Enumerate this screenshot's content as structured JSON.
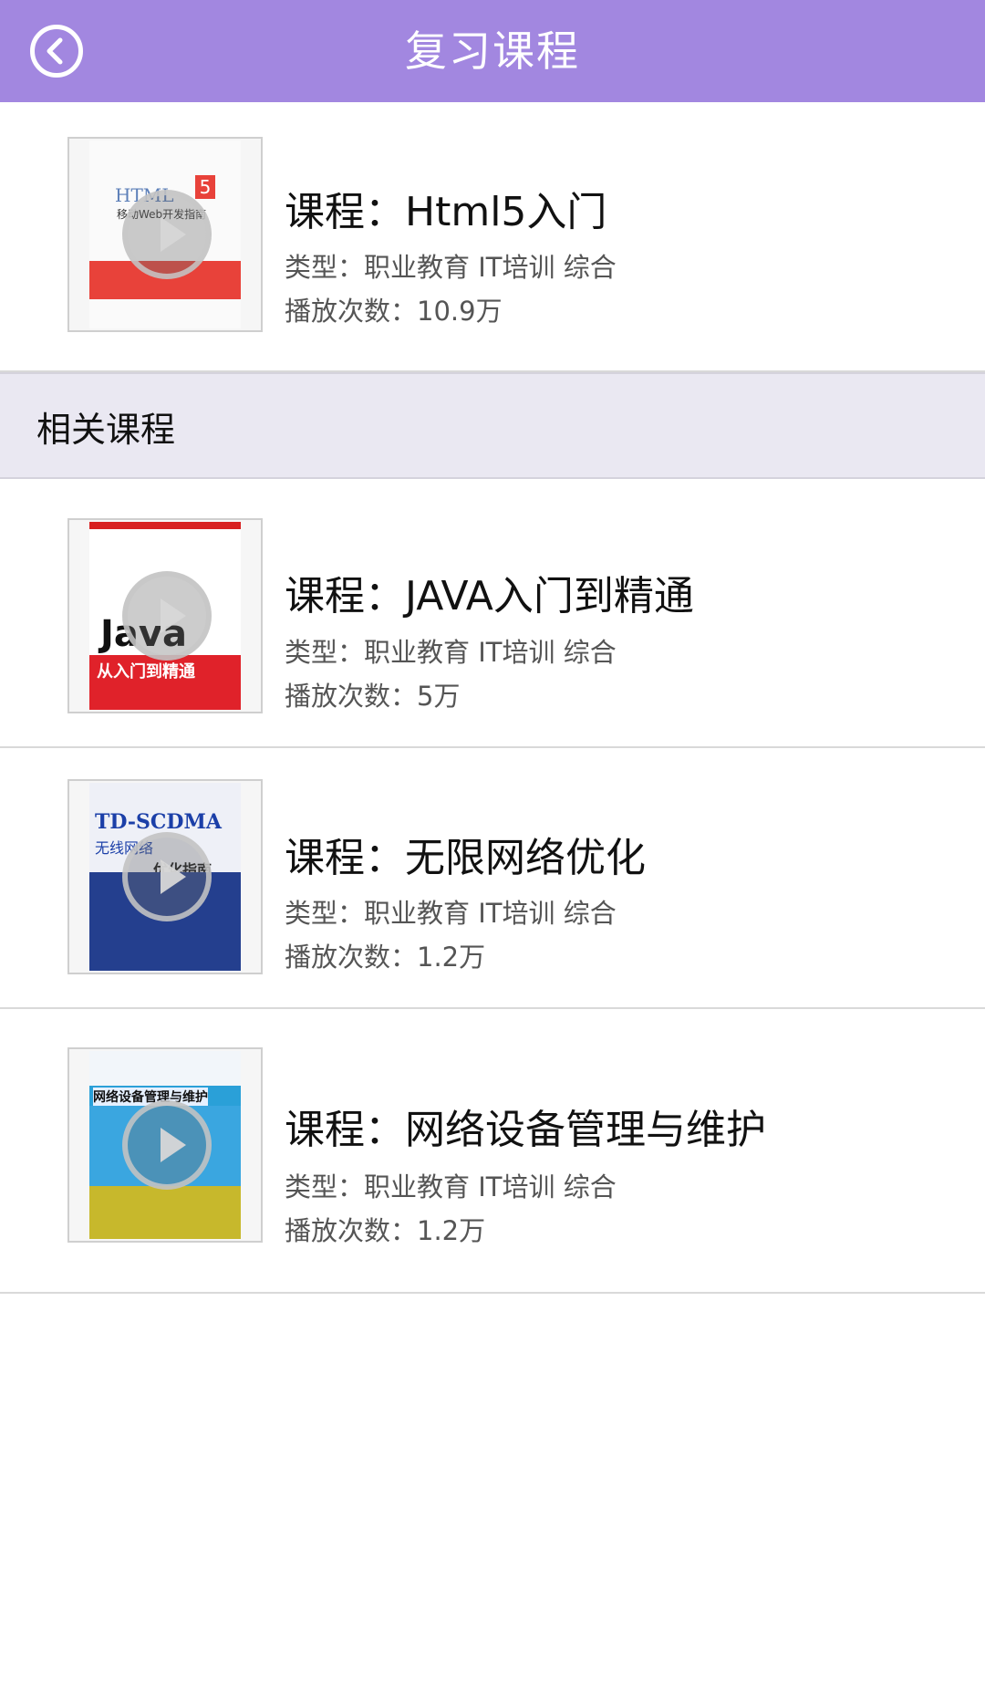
{
  "header": {
    "title": "复习课程",
    "back_icon": "back-arrow-icon",
    "bg_color": "#a287e0"
  },
  "current_course": {
    "title": "课程：Html5入门",
    "type": "类型：职业教育 IT培训 综合",
    "plays": "播放次数：10.9万"
  },
  "related_section": {
    "title": "相关课程"
  },
  "related_courses": [
    {
      "title": "课程：JAVA入门到精通",
      "type": "类型：职业教育 IT培训 综合",
      "plays": "播放次数：5万"
    },
    {
      "title": "课程：无限网络优化",
      "type": "类型：职业教育 IT培训 综合",
      "plays": "播放次数：1.2万"
    },
    {
      "title": "课程：网络设备管理与维护",
      "type": "类型：职业教育 IT培训 综合",
      "plays": "播放次数：1.2万"
    }
  ],
  "covers": {
    "html": {
      "line1": "HTML",
      "line2": "移动Web开发指南",
      "badge": "5"
    },
    "java": {
      "line1": "Java",
      "line2": "从入门到精通"
    },
    "td": {
      "line1": "TD-SCDMA",
      "line2": "无线网络",
      "line3": "优化指南"
    },
    "net": {
      "line1": "网络设备管理与维护"
    }
  }
}
